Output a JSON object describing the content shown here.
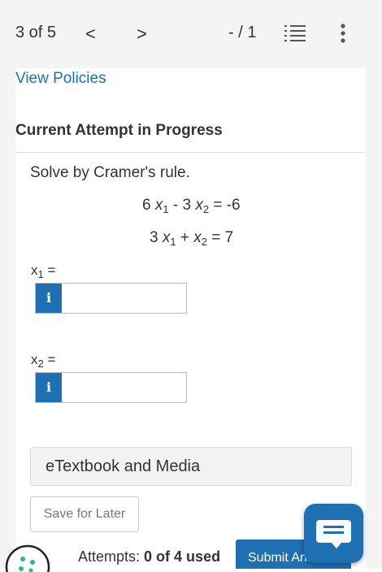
{
  "header": {
    "position": "3 of 5",
    "prev_label": "<",
    "next_label": ">",
    "score": "- / 1",
    "list_icon": "numbered-list-icon",
    "more_icon": "vertical-dots-icon",
    "bg_color": "#f4f4f4"
  },
  "policies_link": "View Policies",
  "section_title": "Current Attempt in Progress",
  "question": {
    "prompt": "Solve by Cramer's rule.",
    "eq1": {
      "c1": "6",
      "v1": "x",
      "s1": "1",
      "op": "- 3",
      "v2": "x",
      "s2": "2",
      "rhs": "= -6"
    },
    "eq2": {
      "c1": "3",
      "v1": "x",
      "s1": "1",
      "op": "+",
      "v2": "x",
      "s2": "2",
      "rhs": "= 7"
    }
  },
  "answers": [
    {
      "var": "x",
      "sub": "1",
      "suffix": "=",
      "info_glyph": "i",
      "value": ""
    },
    {
      "var": "x",
      "sub": "2",
      "suffix": "=",
      "info_glyph": "i",
      "value": ""
    }
  ],
  "etextbook_label": "eTextbook and Media",
  "save_label": "Save for Later",
  "attempts": {
    "prefix": "Attempts:",
    "value": "0 of 4 used"
  },
  "submit_label": "Submit Answer",
  "accent_color": "#1f6fb3"
}
